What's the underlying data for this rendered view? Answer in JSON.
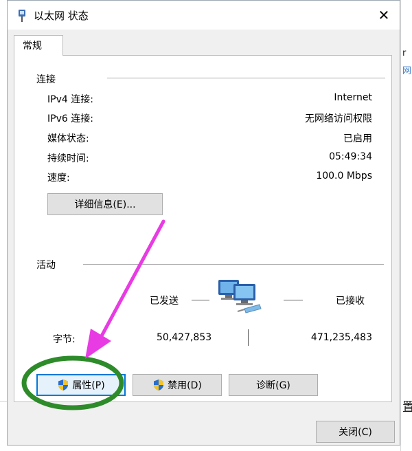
{
  "window": {
    "title": "以太网 状态",
    "close_glyph": "✕"
  },
  "tabs": [
    {
      "label": "常规",
      "selected": true
    }
  ],
  "connection": {
    "group_title": "连接",
    "rows": [
      {
        "label": "IPv4 连接:",
        "value": "Internet"
      },
      {
        "label": "IPv6 连接:",
        "value": "无网络访问权限"
      },
      {
        "label": "媒体状态:",
        "value": "已启用"
      },
      {
        "label": "持续时间:",
        "value": "05:49:34"
      },
      {
        "label": "速度:",
        "value": "100.0 Mbps"
      }
    ],
    "details_button": "详细信息(E)..."
  },
  "activity": {
    "group_title": "活动",
    "sent_label": "已发送",
    "received_label": "已接收",
    "bytes_label": "字节:",
    "bytes_sent": "50,427,853",
    "bytes_received": "471,235,483",
    "icon": "network-computers-icon"
  },
  "actions": {
    "properties": "属性(P)",
    "disable": "禁用(D)",
    "diagnose": "诊断(G)",
    "close": "关闭(C)"
  },
  "background_window": {
    "chars": [
      "r",
      "网",
      "置"
    ]
  },
  "colors": {
    "annotation_arrow": "#e83be3",
    "annotation_circle": "#2e8b2a",
    "shield_blue": "#2a6fc9",
    "shield_yellow": "#f3c52c",
    "focus_blue": "#0078d7"
  }
}
